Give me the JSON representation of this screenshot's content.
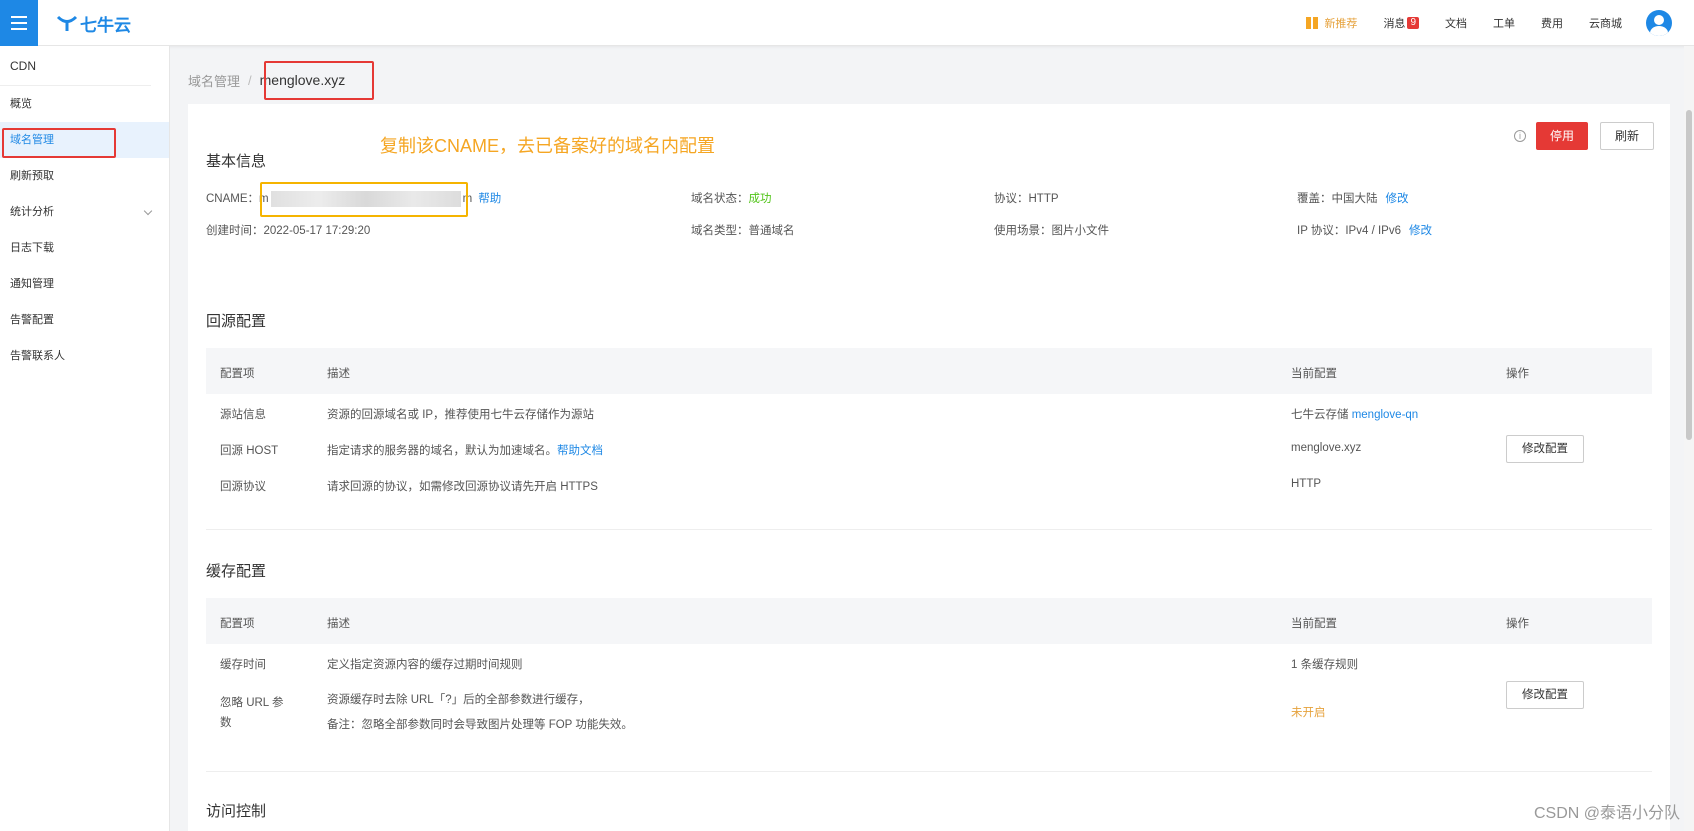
{
  "app": {
    "logo_text": "七牛云"
  },
  "topbar": {
    "promo": "新推荐",
    "messages": "消息",
    "messages_count": "9",
    "docs": "文档",
    "tickets": "工单",
    "billing": "费用",
    "market": "云商城"
  },
  "sidebar": {
    "title": "CDN",
    "items": [
      {
        "label": "概览"
      },
      {
        "label": "域名管理"
      },
      {
        "label": "刷新预取"
      },
      {
        "label": "统计分析"
      },
      {
        "label": "日志下载"
      },
      {
        "label": "通知管理"
      },
      {
        "label": "告警配置"
      },
      {
        "label": "告警联系人"
      }
    ]
  },
  "breadcrumb": {
    "root": "域名管理",
    "sep": "/",
    "current": "menglove.xyz"
  },
  "annotation": "复制该CNAME，去已备案好的域名内配置",
  "basic": {
    "title": "基本信息",
    "cname_label": "CNAME：",
    "cname_prefix": "m",
    "cname_suffix": "m",
    "help": "帮助",
    "created_label": "创建时间：",
    "created_value": "2022-05-17 17:29:20",
    "status_label": "域名状态：",
    "status_value": "成功",
    "type_label": "域名类型：",
    "type_value": "普通域名",
    "protocol_label": "协议：",
    "protocol_value": "HTTP",
    "scene_label": "使用场景：",
    "scene_value": "图片小文件",
    "coverage_label": "覆盖：",
    "coverage_value": "中国大陆",
    "coverage_edit": "修改",
    "ip_label": "IP 协议：",
    "ip_value": "IPv4 / IPv6",
    "ip_edit": "修改",
    "btn_stop": "停用",
    "btn_refresh": "刷新"
  },
  "origin": {
    "title": "回源配置",
    "headers": [
      "配置项",
      "描述",
      "当前配置",
      "操作"
    ],
    "rows": [
      {
        "item": "源站信息",
        "desc": "资源的回源域名或 IP，推荐使用七牛云存储作为源站",
        "current_prefix": "七牛云存储",
        "current_link": "menglove-qn"
      },
      {
        "item": "回源 HOST",
        "desc": "指定请求的服务器的域名，默认为加速域名。",
        "desc_link": "帮助文档",
        "current": "menglove.xyz"
      },
      {
        "item": "回源协议",
        "desc": "请求回源的协议，如需修改回源协议请先开启 HTTPS",
        "current": "HTTP"
      }
    ],
    "btn_modify": "修改配置"
  },
  "cache": {
    "title": "缓存配置",
    "headers": [
      "配置项",
      "描述",
      "当前配置",
      "操作"
    ],
    "rows": [
      {
        "item": "缓存时间",
        "desc": "定义指定资源内容的缓存过期时间规则",
        "current": "1 条缓存规则"
      },
      {
        "item_line1": "忽略 URL 参",
        "item_line2": "数",
        "desc_line1": "资源缓存时去除 URL「?」后的全部参数进行缓存，",
        "desc_line2": "备注：忽略全部参数同时会导致图片处理等 FOP 功能失效。",
        "current": "未开启"
      }
    ],
    "btn_modify": "修改配置"
  },
  "access": {
    "title": "访问控制"
  },
  "watermark": "CSDN @泰语小分队"
}
